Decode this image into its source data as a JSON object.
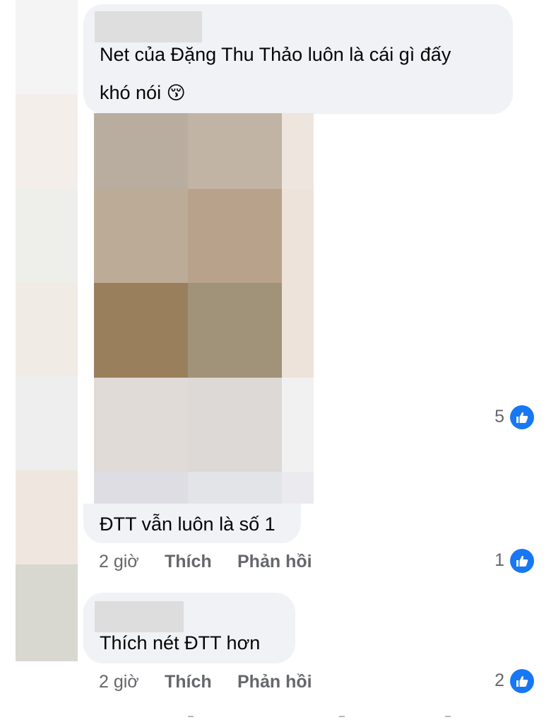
{
  "comments": [
    {
      "text_lines": [
        "Net của Đặng Thu Thảo luôn là cái gì đấy",
        "khó nói"
      ],
      "emoji": "😚",
      "reaction_count": "5"
    },
    {
      "text": "ĐTT vẫn luôn là số 1",
      "time": "2 giờ",
      "like_label": "Thích",
      "reply_label": "Phản hồi",
      "reaction_count": "1"
    },
    {
      "text": "Thích nét ĐTT hơn",
      "time": "2 giờ",
      "like_label": "Thích",
      "reply_label": "Phản hồi",
      "reaction_count": "2"
    }
  ],
  "icons": {
    "reaction": "like-thumbs-up-icon"
  },
  "colors": {
    "bubble": "#f0f2f5",
    "meta_text": "#65676b",
    "like_blue": "#1877f2"
  }
}
